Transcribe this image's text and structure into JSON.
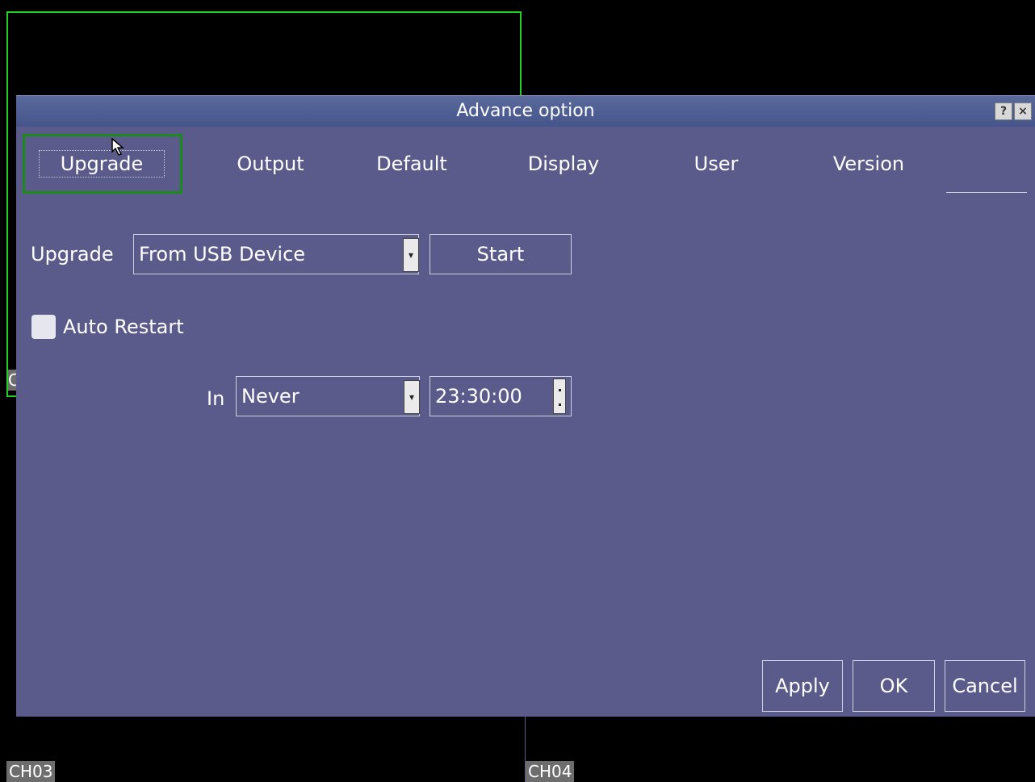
{
  "channels": {
    "ch01_label": "C",
    "ch03_label": "CH03",
    "ch04_label": "CH04"
  },
  "dialog": {
    "title": "Advance option",
    "help_icon": "?",
    "close_icon": "×"
  },
  "tabs": [
    {
      "label": "Upgrade"
    },
    {
      "label": "Output"
    },
    {
      "label": "Default"
    },
    {
      "label": "Display"
    },
    {
      "label": "User"
    },
    {
      "label": "Version"
    }
  ],
  "upgrade": {
    "label": "Upgrade",
    "source_value": "From USB Device",
    "start_label": "Start"
  },
  "auto_restart": {
    "label": "Auto Restart",
    "checked": false,
    "in_label": "In",
    "interval_value": "Never",
    "time_value": "23:30:00"
  },
  "footer": {
    "apply_label": "Apply",
    "ok_label": "OK",
    "cancel_label": "Cancel"
  },
  "colors": {
    "dialog_bg": "#5b5b8b",
    "active_tab_frame": "#1a8a1a",
    "selected_channel_border": "#1fd21f"
  }
}
